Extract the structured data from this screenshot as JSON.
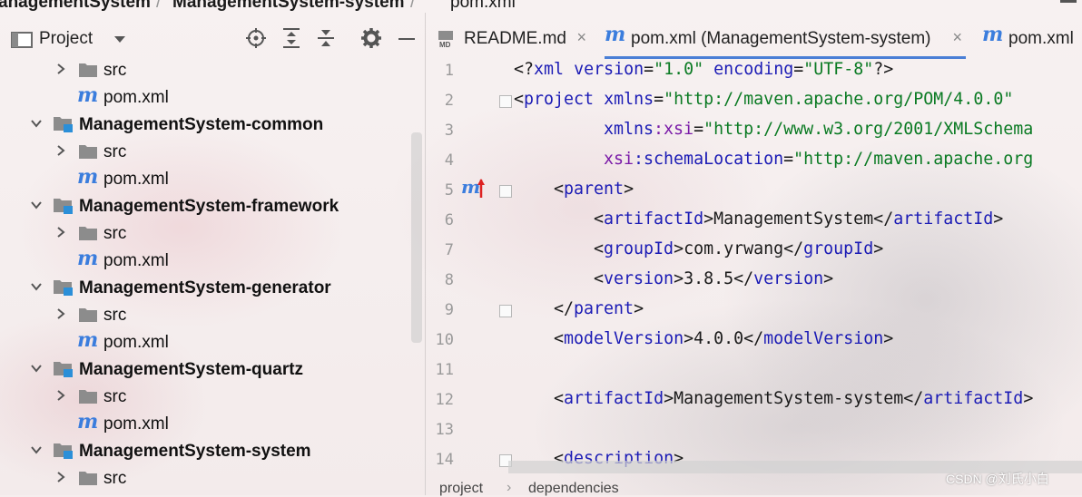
{
  "breadcrumb": {
    "items": [
      "anagementSystem",
      "ManagementSystem-system",
      "pom.xml"
    ]
  },
  "panel": {
    "title": "Project",
    "icons": [
      "target-icon",
      "expand-all-icon",
      "collapse-all-icon",
      "gear-icon",
      "minimize-icon"
    ]
  },
  "tree": [
    {
      "kind": "folder",
      "label": "src",
      "indent": 1,
      "expanded": false
    },
    {
      "kind": "pom",
      "label": "pom.xml",
      "indent": 1
    },
    {
      "kind": "module",
      "label": "ManagementSystem-common",
      "expanded": true
    },
    {
      "kind": "folder",
      "label": "src",
      "indent": 1,
      "expanded": false
    },
    {
      "kind": "pom",
      "label": "pom.xml",
      "indent": 1
    },
    {
      "kind": "module",
      "label": "ManagementSystem-framework",
      "expanded": true
    },
    {
      "kind": "folder",
      "label": "src",
      "indent": 1,
      "expanded": false
    },
    {
      "kind": "pom",
      "label": "pom.xml",
      "indent": 1
    },
    {
      "kind": "module",
      "label": "ManagementSystem-generator",
      "expanded": true
    },
    {
      "kind": "folder",
      "label": "src",
      "indent": 1,
      "expanded": false
    },
    {
      "kind": "pom",
      "label": "pom.xml",
      "indent": 1
    },
    {
      "kind": "module",
      "label": "ManagementSystem-quartz",
      "expanded": true
    },
    {
      "kind": "folder",
      "label": "src",
      "indent": 1,
      "expanded": false
    },
    {
      "kind": "pom",
      "label": "pom.xml",
      "indent": 1
    },
    {
      "kind": "module",
      "label": "ManagementSystem-system",
      "expanded": true
    },
    {
      "kind": "folder",
      "label": "src",
      "indent": 1,
      "expanded": false
    }
  ],
  "tabs": [
    {
      "label": "README.md",
      "icon": "markdown-icon",
      "active": false,
      "close": "×"
    },
    {
      "label": "pom.xml (ManagementSystem-system)",
      "icon": "maven-icon",
      "active": true,
      "close": "×"
    },
    {
      "label": "pom.xml",
      "icon": "maven-icon",
      "active": false
    }
  ],
  "editor": {
    "lines": [
      {
        "n": "1",
        "indent": 0,
        "parts": [
          [
            "p",
            "<?"
          ],
          [
            "t",
            "xml"
          ],
          [
            "p",
            " "
          ],
          [
            "a",
            "version"
          ],
          [
            "p",
            "="
          ],
          [
            "v",
            "\"1.0\""
          ],
          [
            "p",
            " "
          ],
          [
            "a",
            "encoding"
          ],
          [
            "p",
            "="
          ],
          [
            "v",
            "\"UTF-8\""
          ],
          [
            "p",
            "?>"
          ]
        ]
      },
      {
        "n": "2",
        "indent": 0,
        "parts": [
          [
            "p",
            "<"
          ],
          [
            "t",
            "project"
          ],
          [
            "p",
            " "
          ],
          [
            "a",
            "xmlns"
          ],
          [
            "p",
            "="
          ],
          [
            "v",
            "\"http://maven.apache.org/POM/4.0.0\""
          ]
        ]
      },
      {
        "n": "3",
        "indent": 9,
        "parts": [
          [
            "a",
            "xmlns"
          ],
          [
            "n",
            ":xsi"
          ],
          [
            "p",
            "="
          ],
          [
            "v",
            "\"http://www.w3.org/2001/XMLSchema"
          ]
        ]
      },
      {
        "n": "4",
        "indent": 9,
        "parts": [
          [
            "n",
            "xsi"
          ],
          [
            "a",
            ":schemaLocation"
          ],
          [
            "p",
            "="
          ],
          [
            "v",
            "\"http://maven.apache.org"
          ]
        ]
      },
      {
        "n": "5",
        "indent": 4,
        "parts": [
          [
            "p",
            "<"
          ],
          [
            "t",
            "parent"
          ],
          [
            "p",
            ">"
          ]
        ]
      },
      {
        "n": "6",
        "indent": 8,
        "parts": [
          [
            "p",
            "<"
          ],
          [
            "t",
            "artifactId"
          ],
          [
            "p",
            ">ManagementSystem</"
          ],
          [
            "t",
            "artifactId"
          ],
          [
            "p",
            ">"
          ]
        ]
      },
      {
        "n": "7",
        "indent": 8,
        "parts": [
          [
            "p",
            "<"
          ],
          [
            "t",
            "groupId"
          ],
          [
            "p",
            ">com.yrwang</"
          ],
          [
            "t",
            "groupId"
          ],
          [
            "p",
            ">"
          ]
        ]
      },
      {
        "n": "8",
        "indent": 8,
        "parts": [
          [
            "p",
            "<"
          ],
          [
            "t",
            "version"
          ],
          [
            "p",
            ">3.8.5</"
          ],
          [
            "t",
            "version"
          ],
          [
            "p",
            ">"
          ]
        ]
      },
      {
        "n": "9",
        "indent": 4,
        "parts": [
          [
            "p",
            "</"
          ],
          [
            "t",
            "parent"
          ],
          [
            "p",
            ">"
          ]
        ]
      },
      {
        "n": "10",
        "indent": 4,
        "parts": [
          [
            "p",
            "<"
          ],
          [
            "t",
            "modelVersion"
          ],
          [
            "p",
            ">4.0.0</"
          ],
          [
            "t",
            "modelVersion"
          ],
          [
            "p",
            ">"
          ]
        ]
      },
      {
        "n": "11",
        "indent": 0,
        "parts": []
      },
      {
        "n": "12",
        "indent": 4,
        "parts": [
          [
            "p",
            "<"
          ],
          [
            "t",
            "artifactId"
          ],
          [
            "p",
            ">ManagementSystem-system</"
          ],
          [
            "t",
            "artifactId"
          ],
          [
            "p",
            ">"
          ]
        ]
      },
      {
        "n": "13",
        "indent": 0,
        "parts": []
      },
      {
        "n": "14",
        "indent": 4,
        "parts": [
          [
            "p",
            "<"
          ],
          [
            "t",
            "description"
          ],
          [
            "p",
            ">"
          ]
        ]
      }
    ]
  },
  "bottom_breadcrumb": [
    "project",
    "dependencies"
  ],
  "watermark": "CSDN @刘氏小白"
}
